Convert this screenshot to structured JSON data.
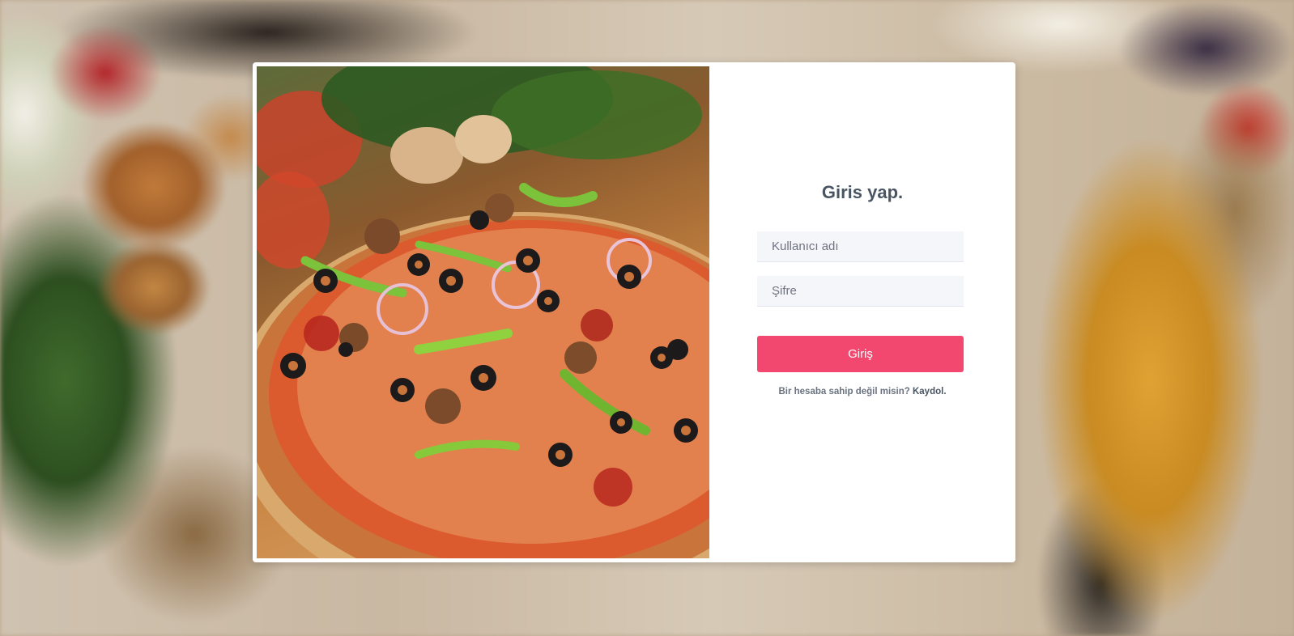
{
  "login": {
    "title_bold": "Giris",
    "title_rest": " yap.",
    "username_placeholder": "Kullanıcı adı",
    "password_placeholder": "Şifre",
    "submit_label": "Giriş",
    "signup_prompt": "Bir hesaba sahip değil misin? ",
    "signup_link": "Kaydol."
  },
  "colors": {
    "accent": "#f2476f",
    "title_text": "#4a5563",
    "input_background": "#f5f6fa"
  }
}
